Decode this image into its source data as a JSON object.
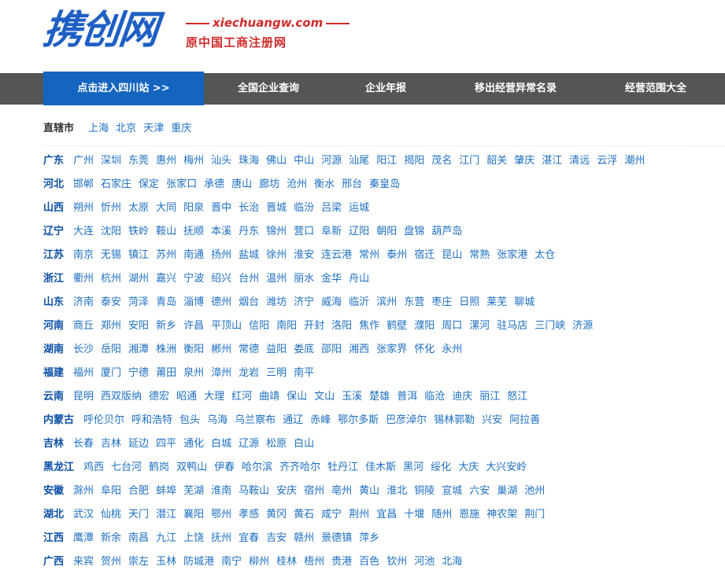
{
  "header": {
    "logo_text": "携创网",
    "tagline_url": "xiechuangw.com",
    "tagline_sub": "原中国工商注册网"
  },
  "nav": {
    "items": [
      {
        "label": "点击进入四川站 >>",
        "active": true
      },
      {
        "label": "全国企业查询"
      },
      {
        "label": "企业年报"
      },
      {
        "label": "移出经营异常名录"
      },
      {
        "label": "经营范围大全"
      }
    ]
  },
  "municipalities": {
    "label": "直辖市",
    "cities": [
      "上海",
      "北京",
      "天津",
      "重庆"
    ]
  },
  "provinces": [
    {
      "name": "广东",
      "cities": [
        "广州",
        "深圳",
        "东莞",
        "惠州",
        "梅州",
        "汕头",
        "珠海",
        "佛山",
        "中山",
        "河源",
        "汕尾",
        "阳江",
        "揭阳",
        "茂名",
        "江门",
        "韶关",
        "肇庆",
        "湛江",
        "清远",
        "云浮",
        "潮州"
      ]
    },
    {
      "name": "河北",
      "cities": [
        "邯郸",
        "石家庄",
        "保定",
        "张家口",
        "承德",
        "唐山",
        "廊坊",
        "沧州",
        "衡水",
        "邢台",
        "秦皇岛"
      ]
    },
    {
      "name": "山西",
      "cities": [
        "朔州",
        "忻州",
        "太原",
        "大同",
        "阳泉",
        "晋中",
        "长治",
        "晋城",
        "临汾",
        "吕梁",
        "运城"
      ]
    },
    {
      "name": "辽宁",
      "cities": [
        "大连",
        "沈阳",
        "铁岭",
        "鞍山",
        "抚顺",
        "本溪",
        "丹东",
        "锦州",
        "营口",
        "阜新",
        "辽阳",
        "朝阳",
        "盘锦",
        "葫芦岛"
      ]
    },
    {
      "name": "江苏",
      "cities": [
        "南京",
        "无锡",
        "镇江",
        "苏州",
        "南通",
        "扬州",
        "盐城",
        "徐州",
        "淮安",
        "连云港",
        "常州",
        "泰州",
        "宿迁",
        "昆山",
        "常熟",
        "张家港",
        "太仓"
      ]
    },
    {
      "name": "浙江",
      "cities": [
        "衢州",
        "杭州",
        "湖州",
        "嘉兴",
        "宁波",
        "绍兴",
        "台州",
        "温州",
        "丽水",
        "金华",
        "舟山"
      ]
    },
    {
      "name": "山东",
      "cities": [
        "济南",
        "泰安",
        "菏泽",
        "青岛",
        "淄博",
        "德州",
        "烟台",
        "潍坊",
        "济宁",
        "威海",
        "临沂",
        "滨州",
        "东营",
        "枣庄",
        "日照",
        "莱芜",
        "聊城"
      ]
    },
    {
      "name": "河南",
      "cities": [
        "商丘",
        "郑州",
        "安阳",
        "新乡",
        "许昌",
        "平顶山",
        "信阳",
        "南阳",
        "开封",
        "洛阳",
        "焦作",
        "鹤壁",
        "濮阳",
        "周口",
        "漯河",
        "驻马店",
        "三门峡",
        "济源"
      ]
    },
    {
      "name": "湖南",
      "cities": [
        "长沙",
        "岳阳",
        "湘潭",
        "株洲",
        "衡阳",
        "郴州",
        "常德",
        "益阳",
        "娄底",
        "邵阳",
        "湘西",
        "张家界",
        "怀化",
        "永州"
      ]
    },
    {
      "name": "福建",
      "cities": [
        "福州",
        "厦门",
        "宁德",
        "莆田",
        "泉州",
        "漳州",
        "龙岩",
        "三明",
        "南平"
      ]
    },
    {
      "name": "云南",
      "cities": [
        "昆明",
        "西双版纳",
        "德宏",
        "昭通",
        "大理",
        "红河",
        "曲靖",
        "保山",
        "文山",
        "玉溪",
        "楚雄",
        "普洱",
        "临沧",
        "迪庆",
        "丽江",
        "怒江"
      ]
    },
    {
      "name": "内蒙古",
      "cities": [
        "呼伦贝尔",
        "呼和浩特",
        "包头",
        "乌海",
        "乌兰察布",
        "通辽",
        "赤峰",
        "鄂尔多斯",
        "巴彦淖尔",
        "锡林郭勒",
        "兴安",
        "阿拉善"
      ]
    },
    {
      "name": "吉林",
      "cities": [
        "长春",
        "吉林",
        "延边",
        "四平",
        "通化",
        "白城",
        "辽源",
        "松原",
        "白山"
      ]
    },
    {
      "name": "黑龙江",
      "cities": [
        "鸡西",
        "七台河",
        "鹤岗",
        "双鸭山",
        "伊春",
        "哈尔滨",
        "齐齐哈尔",
        "牡丹江",
        "佳木斯",
        "黑河",
        "绥化",
        "大庆",
        "大兴安岭"
      ]
    },
    {
      "name": "安徽",
      "cities": [
        "滁州",
        "阜阳",
        "合肥",
        "蚌埠",
        "芜湖",
        "淮南",
        "马鞍山",
        "安庆",
        "宿州",
        "亳州",
        "黄山",
        "淮北",
        "铜陵",
        "宣城",
        "六安",
        "巢湖",
        "池州"
      ]
    },
    {
      "name": "湖北",
      "cities": [
        "武汉",
        "仙桃",
        "天门",
        "潜江",
        "襄阳",
        "鄂州",
        "孝感",
        "黄冈",
        "黄石",
        "咸宁",
        "荆州",
        "宜昌",
        "十堰",
        "随州",
        "恩施",
        "神农架",
        "荆门"
      ]
    },
    {
      "name": "江西",
      "cities": [
        "鹰潭",
        "新余",
        "南昌",
        "九江",
        "上饶",
        "抚州",
        "宜春",
        "吉安",
        "赣州",
        "景德镇",
        "萍乡"
      ]
    },
    {
      "name": "广西",
      "cities": [
        "来宾",
        "贺州",
        "崇左",
        "玉林",
        "防城港",
        "南宁",
        "柳州",
        "桂林",
        "梧州",
        "贵港",
        "百色",
        "钦州",
        "河池",
        "北海"
      ]
    }
  ]
}
